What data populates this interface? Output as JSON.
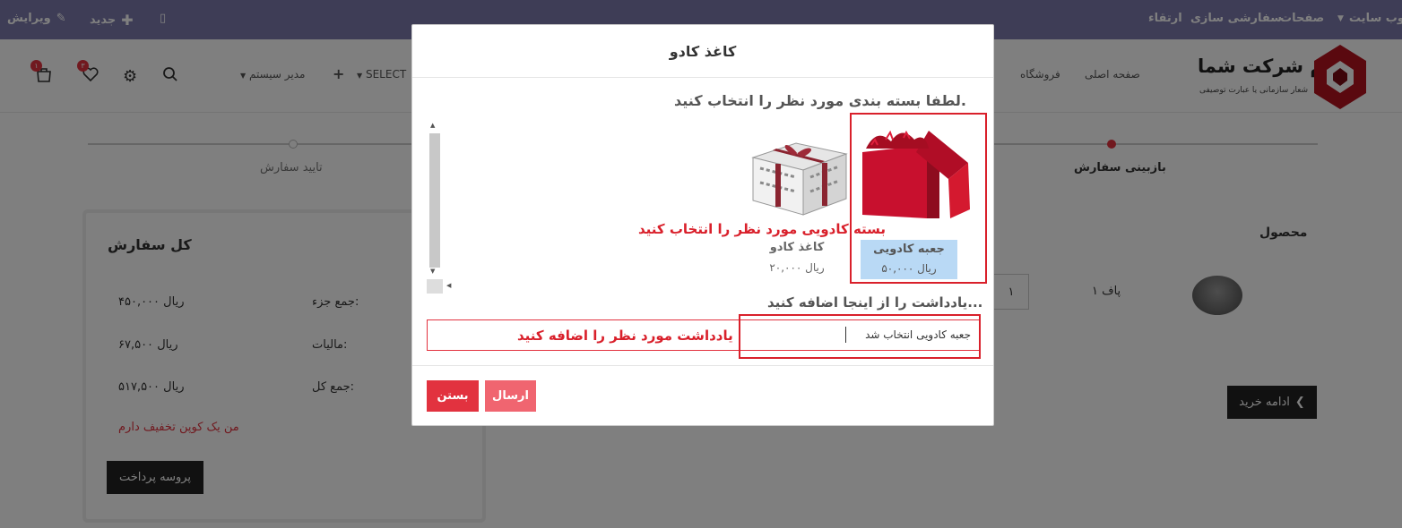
{
  "topbar": {
    "edit": "ویرایش",
    "new": "جدید",
    "website": "وب سایت",
    "pages": "صفحات",
    "customize": "سفارشی سازی",
    "upgrade": "ارتقاء"
  },
  "header": {
    "brand_name": "نام شرکت شما",
    "brand_slogan": "شعار سازمانی یا عبارت توصیفی",
    "nav_home": "صفحه اصلی",
    "nav_shop": "فروشگاه",
    "nav_admin": "مدیر سیستم",
    "nav_select": "SELECT",
    "cart_count": "۱",
    "wishlist_count": "۳"
  },
  "checkout": {
    "step_review": "بازبینی سفارش",
    "step_confirm": "تایید سفارش",
    "product_header": "محصول",
    "product_name": "پاف ۱",
    "quantity": "۱",
    "continue_shopping": "ادامه خرید"
  },
  "summary": {
    "title": "کل سفارش",
    "subtotal_label": "جمع جزء:",
    "subtotal_value": "۴۵۰,۰۰۰ ریال",
    "tax_label": "مالیات:",
    "tax_value": "۶۷,۵۰۰ ریال",
    "total_label": "جمع کل:",
    "total_value": "۵۱۷,۵۰۰ ریال",
    "coupon_link": "من یک کوپن تخفیف دارم",
    "checkout_button": "پروسه پرداخت"
  },
  "modal": {
    "title": "کاغذ کادو",
    "instruction": "لطفا بسته بندی مورد نظر را انتخاب کنید.",
    "options": [
      {
        "name": "جعبه کادویی",
        "price": "۵۰,۰۰۰ ریال",
        "selected": true
      },
      {
        "name": "کاغذ کادو",
        "price": "۲۰,۰۰۰ ریال",
        "selected": false
      }
    ],
    "annotation_select": "بسته کادویی مورد نظر را انتخاب کنید",
    "note_label": "یادداشت را از اینجا اضافه کنید...",
    "note_value": "جعبه کادویی انتخاب شد",
    "annotation_note": "یادداشت مورد نظر را اضافه کنید",
    "send_button": "ارسال",
    "close_button": "بستن"
  },
  "colors": {
    "topbar": "#7c7bad",
    "accent_red": "#e2323f",
    "annotation_red": "#d9202b",
    "selected_bg": "#b9d9f5"
  }
}
